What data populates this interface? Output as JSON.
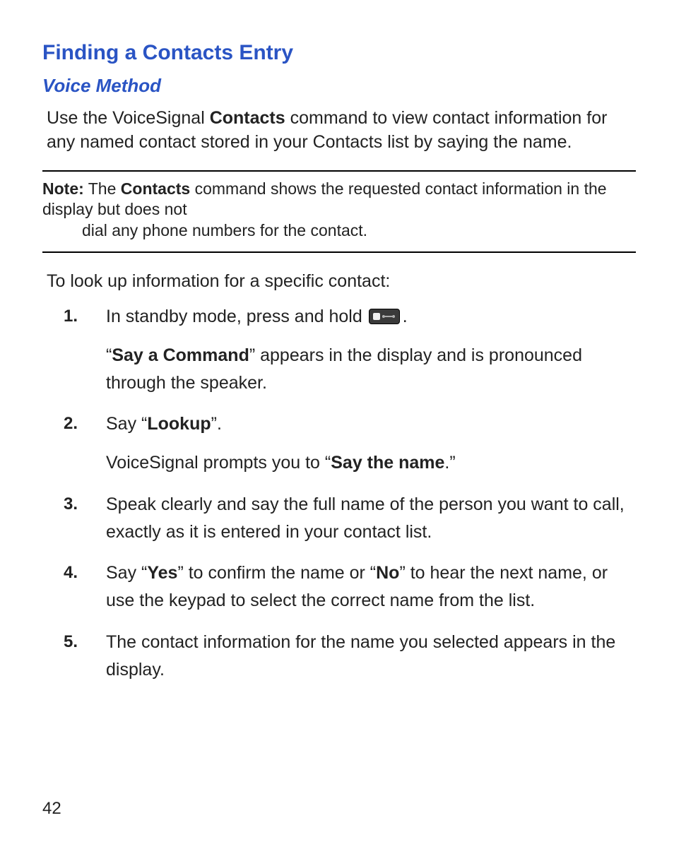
{
  "heading": "Finding a Contacts Entry",
  "subheading": "Voice Method",
  "intro": {
    "pre": "Use the VoiceSignal ",
    "bold": "Contacts",
    "post": " command to view contact information for any named contact stored in your Contacts list by saying the name."
  },
  "note": {
    "label": "Note:",
    "line1_pre": " The ",
    "line1_bold": "Contacts",
    "line1_post": " command shows the requested contact information in the display but does not",
    "line2": "dial any phone numbers for the contact."
  },
  "lead": "To look up information for a specific contact:",
  "steps": {
    "s1": {
      "a": "In standby mode, press and hold ",
      "b": ".",
      "sub_pre": "“",
      "sub_bold": "Say a Command",
      "sub_post": "” appears in the display and is pronounced through the speaker."
    },
    "s2": {
      "a": "Say “",
      "bold": "Lookup",
      "b": "”.",
      "sub_pre": "VoiceSignal prompts you to “",
      "sub_bold": "Say the name",
      "sub_post": ".”"
    },
    "s3": {
      "text": "Speak clearly and say the full name of the person you want to call, exactly as it is entered in your contact list."
    },
    "s4": {
      "a": "Say “",
      "bold1": "Yes",
      "mid": "” to confirm the name or “",
      "bold2": "No",
      "b": "” to hear the next name, or use the keypad to select the correct name from the list."
    },
    "s5": {
      "text": "The contact information for the name you selected appears in the display."
    }
  },
  "page_number": "42"
}
